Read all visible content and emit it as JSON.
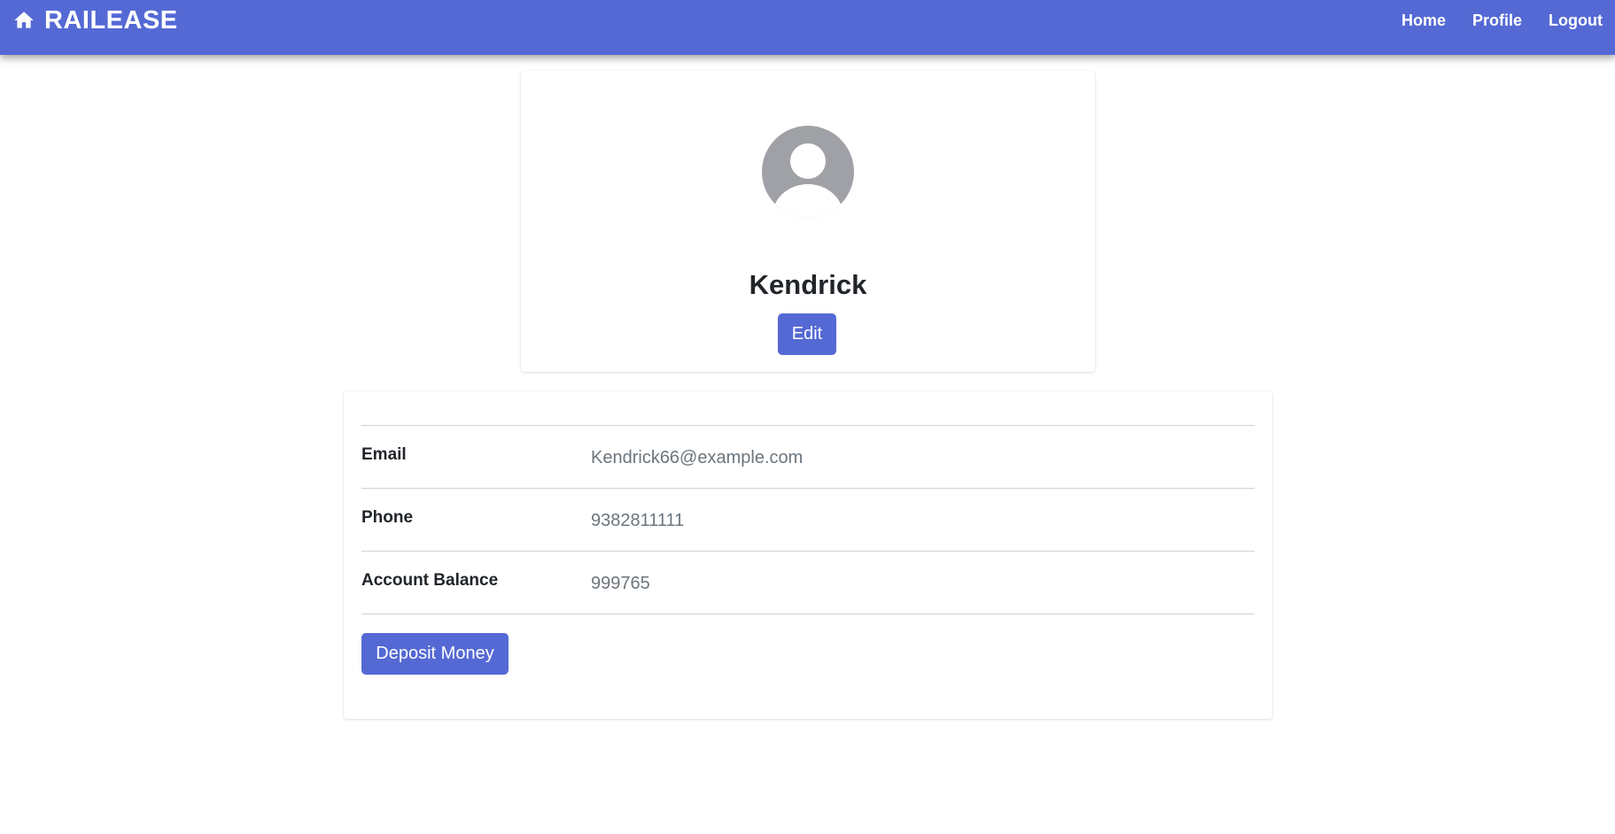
{
  "navbar": {
    "brand": "RAILEASE",
    "links": [
      "Home",
      "Profile",
      "Logout"
    ]
  },
  "profile": {
    "name": "Kendrick",
    "edit_label": "Edit"
  },
  "details": {
    "rows": [
      {
        "label": "Email",
        "value": "Kendrick66@example.com"
      },
      {
        "label": "Phone",
        "value": "9382811111"
      },
      {
        "label": "Account Balance",
        "value": "999765"
      }
    ],
    "deposit_label": "Deposit Money"
  },
  "colors": {
    "primary": "#5469d4",
    "avatar": "#9fa1a6",
    "muted_text": "#6c757d"
  },
  "icons": {
    "brand": "home-icon",
    "avatar": "user-avatar-icon"
  }
}
